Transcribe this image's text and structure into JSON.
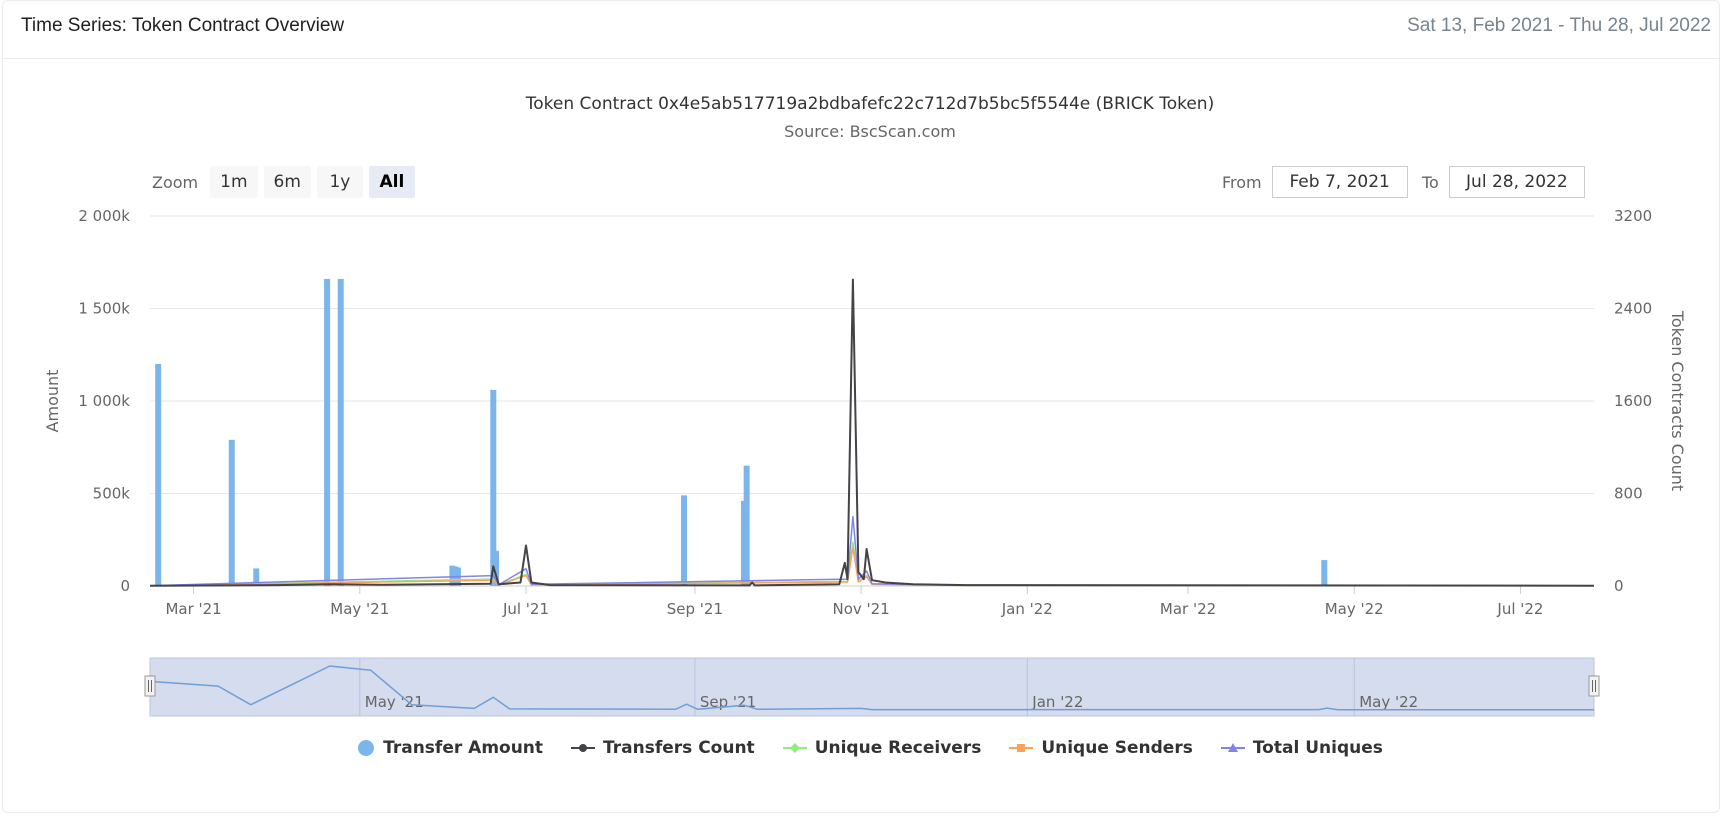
{
  "header": {
    "title": "Time Series: Token Contract Overview",
    "date_range": "Sat 13, Feb 2021 - Thu 28, Jul 2022"
  },
  "zoom": {
    "label": "Zoom",
    "buttons": [
      {
        "label": "1m",
        "active": false
      },
      {
        "label": "6m",
        "active": false
      },
      {
        "label": "1y",
        "active": false
      },
      {
        "label": "All",
        "active": true
      }
    ]
  },
  "range": {
    "from_label": "From",
    "from_value": "Feb 7, 2021",
    "to_label": "To",
    "to_value": "Jul 28, 2022"
  },
  "colors": {
    "transfer_amount": "#7cb5ec",
    "transfers_count": "#434348",
    "unique_receivers": "#90ed7d",
    "unique_senders": "#f7a35c",
    "total_uniques": "#8085e9",
    "gridline": "#e6e6e6",
    "navigator_mask": "#ccd6eb",
    "navigator_line": "#6f9fd8"
  },
  "chart_data": {
    "type": "bar",
    "title": "Token Contract 0x4e5ab517719a2bdbafefc22c712d7b5bc5f5544e (BRICK Token)",
    "subtitle": "Source: BscScan.com",
    "x_range": [
      "2021-02-13",
      "2022-07-28"
    ],
    "x_ticks": [
      {
        "date": "2021-03-01",
        "label": "Mar '21"
      },
      {
        "date": "2021-05-01",
        "label": "May '21"
      },
      {
        "date": "2021-07-01",
        "label": "Jul '21"
      },
      {
        "date": "2021-09-01",
        "label": "Sep '21"
      },
      {
        "date": "2021-11-01",
        "label": "Nov '21"
      },
      {
        "date": "2022-01-01",
        "label": "Jan '22"
      },
      {
        "date": "2022-03-01",
        "label": "Mar '22"
      },
      {
        "date": "2022-05-01",
        "label": "May '22"
      },
      {
        "date": "2022-07-01",
        "label": "Jul '22"
      }
    ],
    "navigator_ticks": [
      {
        "date": "2021-05-01",
        "label": "May '21"
      },
      {
        "date": "2021-09-01",
        "label": "Sep '21"
      },
      {
        "date": "2022-01-01",
        "label": "Jan '22"
      },
      {
        "date": "2022-05-01",
        "label": "May '22"
      }
    ],
    "y_left": {
      "title": "Amount",
      "min": 0,
      "max": 2000000,
      "ticks": [
        {
          "value": 0,
          "label": "0"
        },
        {
          "value": 500000,
          "label": "500k"
        },
        {
          "value": 1000000,
          "label": "1 000k"
        },
        {
          "value": 1500000,
          "label": "1 500k"
        },
        {
          "value": 2000000,
          "label": "2 000k"
        }
      ]
    },
    "y_right": {
      "title": "Token Contracts Count",
      "min": 0,
      "max": 3200,
      "ticks": [
        {
          "value": 0,
          "label": "0"
        },
        {
          "value": 800,
          "label": "800"
        },
        {
          "value": 1600,
          "label": "1600"
        },
        {
          "value": 2400,
          "label": "2400"
        },
        {
          "value": 3200,
          "label": "3200"
        }
      ]
    },
    "legend_position": "bottom",
    "grid": true,
    "series": [
      {
        "name": "Transfer Amount",
        "type": "column",
        "axis": "left",
        "points": [
          [
            "2021-02-16",
            1200000
          ],
          [
            "2021-03-15",
            790000
          ],
          [
            "2021-03-24",
            95000
          ],
          [
            "2021-04-19",
            1660000
          ],
          [
            "2021-04-24",
            1660000
          ],
          [
            "2021-06-04",
            110000
          ],
          [
            "2021-06-05",
            105000
          ],
          [
            "2021-06-06",
            100000
          ],
          [
            "2021-06-19",
            1060000
          ],
          [
            "2021-06-20",
            190000
          ],
          [
            "2021-08-28",
            490000
          ],
          [
            "2021-09-19",
            460000
          ],
          [
            "2021-09-20",
            650000
          ],
          [
            "2022-04-20",
            140000
          ]
        ]
      },
      {
        "name": "Transfers Count",
        "type": "line",
        "axis": "right",
        "points": [
          [
            "2021-02-13",
            3
          ],
          [
            "2021-04-01",
            8
          ],
          [
            "2021-04-20",
            15
          ],
          [
            "2021-05-10",
            10
          ],
          [
            "2021-06-18",
            20
          ],
          [
            "2021-06-19",
            170
          ],
          [
            "2021-06-21",
            15
          ],
          [
            "2021-06-29",
            30
          ],
          [
            "2021-07-01",
            350
          ],
          [
            "2021-07-03",
            30
          ],
          [
            "2021-07-10",
            8
          ],
          [
            "2021-09-21",
            5
          ],
          [
            "2021-09-22",
            30
          ],
          [
            "2021-09-23",
            5
          ],
          [
            "2021-10-24",
            15
          ],
          [
            "2021-10-26",
            200
          ],
          [
            "2021-10-27",
            60
          ],
          [
            "2021-10-29",
            2650
          ],
          [
            "2021-10-31",
            120
          ],
          [
            "2021-11-02",
            60
          ],
          [
            "2021-11-03",
            320
          ],
          [
            "2021-11-05",
            50
          ],
          [
            "2021-11-10",
            30
          ],
          [
            "2021-11-20",
            15
          ],
          [
            "2021-12-10",
            8
          ],
          [
            "2022-07-28",
            3
          ]
        ]
      },
      {
        "name": "Unique Receivers",
        "type": "line",
        "axis": "right",
        "points": [
          [
            "2021-02-13",
            2
          ],
          [
            "2021-06-19",
            60
          ],
          [
            "2021-06-21",
            8
          ],
          [
            "2021-07-01",
            100
          ],
          [
            "2021-07-03",
            10
          ],
          [
            "2021-10-27",
            40
          ],
          [
            "2021-10-29",
            380
          ],
          [
            "2021-10-31",
            40
          ],
          [
            "2021-11-03",
            90
          ],
          [
            "2021-11-05",
            15
          ],
          [
            "2021-12-10",
            4
          ],
          [
            "2022-07-28",
            2
          ]
        ]
      },
      {
        "name": "Unique Senders",
        "type": "line",
        "axis": "right",
        "points": [
          [
            "2021-02-13",
            2
          ],
          [
            "2021-06-19",
            50
          ],
          [
            "2021-06-21",
            8
          ],
          [
            "2021-07-01",
            90
          ],
          [
            "2021-07-03",
            10
          ],
          [
            "2021-10-27",
            35
          ],
          [
            "2021-10-29",
            330
          ],
          [
            "2021-10-31",
            35
          ],
          [
            "2021-11-03",
            80
          ],
          [
            "2021-11-05",
            15
          ],
          [
            "2021-12-10",
            4
          ],
          [
            "2022-07-28",
            2
          ]
        ]
      },
      {
        "name": "Total Uniques",
        "type": "line",
        "axis": "right",
        "points": [
          [
            "2021-02-13",
            3
          ],
          [
            "2021-06-19",
            90
          ],
          [
            "2021-06-21",
            10
          ],
          [
            "2021-07-01",
            150
          ],
          [
            "2021-07-03",
            15
          ],
          [
            "2021-10-27",
            60
          ],
          [
            "2021-10-29",
            600
          ],
          [
            "2021-10-31",
            60
          ],
          [
            "2021-11-03",
            130
          ],
          [
            "2021-11-05",
            20
          ],
          [
            "2021-12-10",
            5
          ],
          [
            "2022-07-28",
            3
          ]
        ]
      }
    ]
  }
}
